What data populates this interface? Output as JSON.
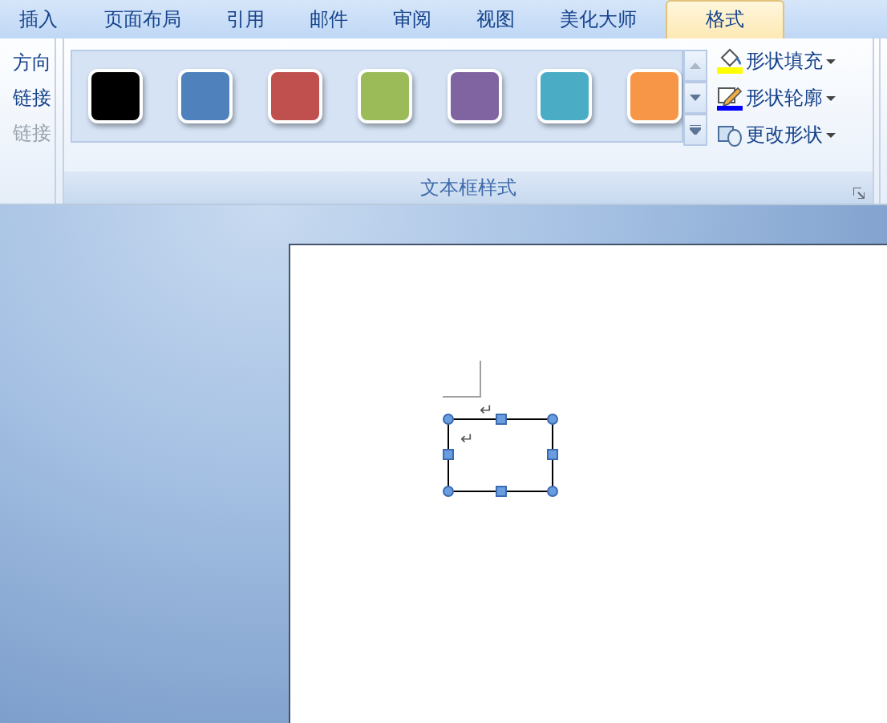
{
  "tabs": [
    {
      "label": "插入",
      "selected": false
    },
    {
      "label": "页面布局",
      "selected": false
    },
    {
      "label": "引用",
      "selected": false
    },
    {
      "label": "邮件",
      "selected": false
    },
    {
      "label": "审阅",
      "selected": false
    },
    {
      "label": "视图",
      "selected": false
    },
    {
      "label": "美化大师",
      "selected": false
    },
    {
      "label": "格式",
      "selected": true
    }
  ],
  "left_group": {
    "items": [
      {
        "label": "方向",
        "disabled": false
      },
      {
        "label": "链接",
        "disabled": false
      },
      {
        "label": "链接",
        "disabled": true
      }
    ]
  },
  "styles_group": {
    "label": "文本框样式",
    "swatches": [
      {
        "color": "#000000"
      },
      {
        "color": "#4f81bd"
      },
      {
        "color": "#c0504d"
      },
      {
        "color": "#9bbb59"
      },
      {
        "color": "#8064a2"
      },
      {
        "color": "#4bacc6"
      },
      {
        "color": "#f79646"
      }
    ],
    "commands": [
      {
        "kind": "fill",
        "label": "形状填充"
      },
      {
        "kind": "outline",
        "label": "形状轮廓"
      },
      {
        "kind": "change",
        "label": "更改形状"
      }
    ]
  },
  "document": {
    "paragraph_mark": "↵",
    "anchor_mark": "↵"
  }
}
